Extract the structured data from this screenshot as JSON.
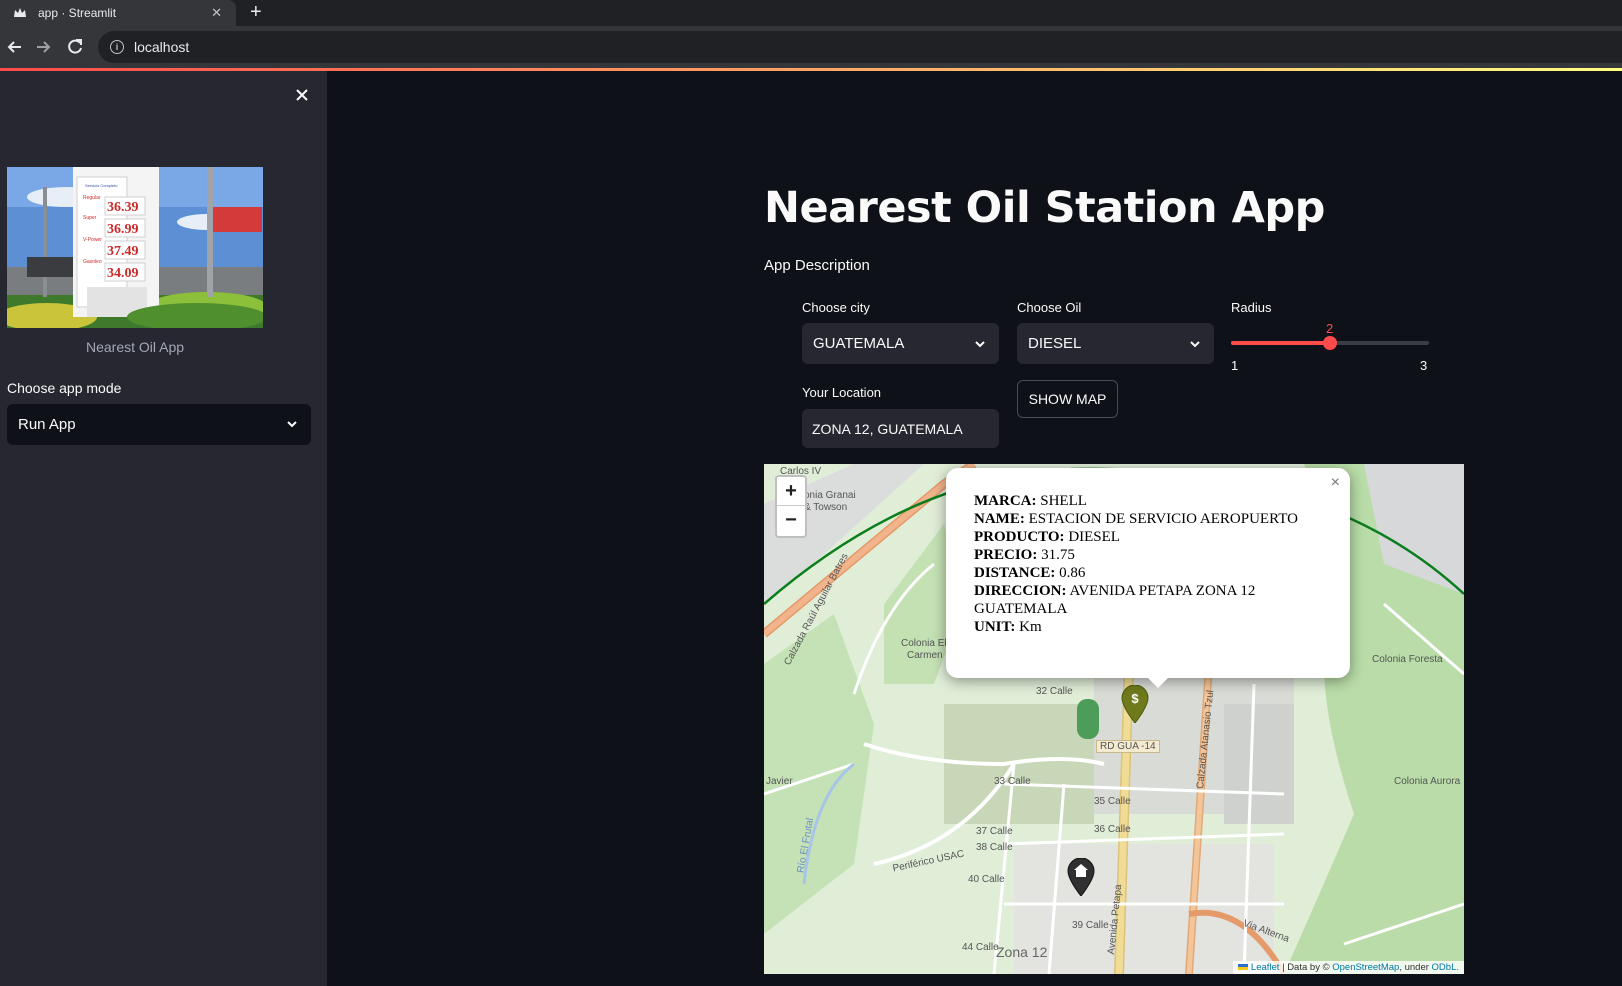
{
  "browser": {
    "tab_title": "app · Streamlit",
    "url": "localhost"
  },
  "sidebar": {
    "image_caption": "Nearest Oil App",
    "image_sign_prices": [
      "36.39",
      "36.99",
      "37.49",
      "34.09"
    ],
    "mode_label": "Choose app mode",
    "mode_value": "Run App"
  },
  "main": {
    "title": "Nearest Oil Station App",
    "description": "App Description",
    "city_label": "Choose city",
    "city_value": "GUATEMALA",
    "oil_label": "Choose Oil",
    "oil_value": "DIESEL",
    "radius_label": "Radius",
    "radius_value": "2",
    "radius_min": "1",
    "radius_max": "3",
    "radius_fraction": 0.5,
    "location_label": "Your Location",
    "location_value": "ZONA 12, GUATEMALA",
    "show_map_label": "SHOW MAP"
  },
  "map": {
    "zoom_in": "+",
    "zoom_out": "−",
    "popup": {
      "marca_key": "MARCA:",
      "marca": "SHELL",
      "name_key": "NAME:",
      "name": "ESTACION DE SERVICIO AEROPUERTO",
      "producto_key": "PRODUCTO:",
      "producto": "DIESEL",
      "precio_key": "PRECIO:",
      "precio": "31.75",
      "distance_key": "DISTANCE:",
      "distance": "0.86",
      "direccion_key": "DIRECCION:",
      "direccion": "AVENIDA PETAPA ZONA 12 GUATEMALA",
      "unit_key": "UNIT:",
      "unit": "Km",
      "close": "×"
    },
    "labels": {
      "carlos": "Carlos IV",
      "granai": "onia Granai",
      "towson": "& Towson",
      "colonia_el_carmen_1": "Colonia El",
      "colonia_el_carmen_2": "Carmen",
      "colonia_foresta": "Colonia Foresta",
      "colonia_aurora": "Colonia Aurora",
      "calle32": "32 Calle",
      "calle33": "33 Calle",
      "calle35": "35 Calle",
      "calle36": "36 Calle",
      "calle37": "37 Calle",
      "calle38": "38 Calle",
      "calle39": "39 Calle",
      "calle40": "40 Calle",
      "calle44": "44 Calle",
      "rd_gua": "RD GUA -14",
      "zona12": "Zona 12",
      "periferico": "Periférico USAC",
      "via_alterna": "Via Alterna",
      "calzada_raul": "Calzada Raúl Aguilar Batres",
      "calzada_atanasio": "Calzada Atanasio Tzul",
      "avenida_petapa": "Avenida Petapa",
      "rio_el_frutal": "Río El Frutal",
      "javier": "Javier"
    },
    "attribution": {
      "leaflet": "Leaflet",
      "data_by": "| Data by ©",
      "osm": "OpenStreetMap",
      "under": ", under",
      "odbl": "ODbL."
    },
    "station_marker_icon": "dollar-icon",
    "home_marker_icon": "home-icon"
  }
}
